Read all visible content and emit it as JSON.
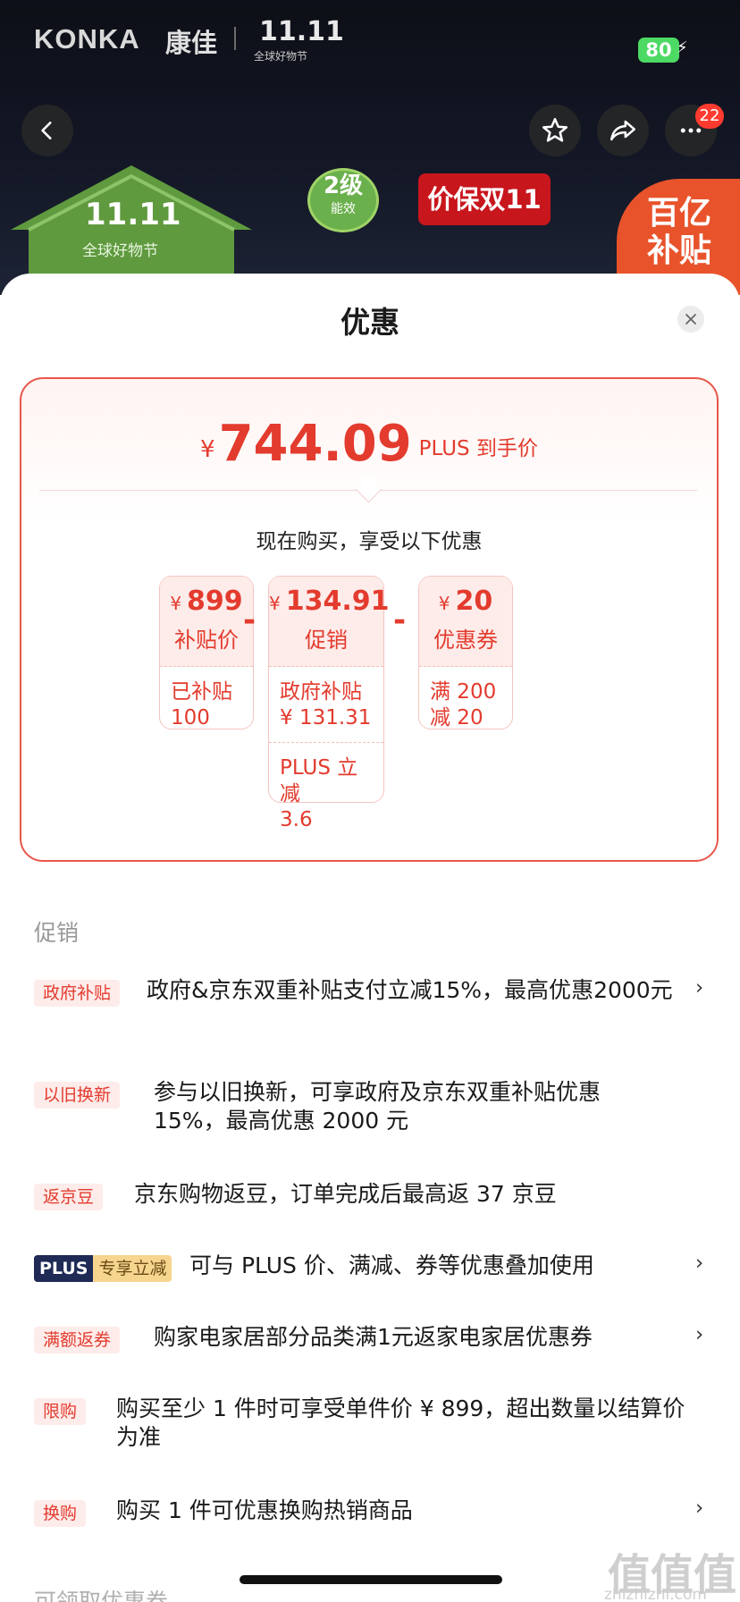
{
  "header": {
    "brand": "KONKA",
    "brand_cn": "康佳",
    "event_logo": "11.11",
    "event_sub": "全球好物节",
    "battery": "80",
    "cart_badge": "22",
    "banner_house_title": "11.11",
    "banner_house_sub": "全球好物节",
    "energy_level": "2级",
    "energy_label": "能效",
    "price_protect": "价保双11",
    "subsidy_line1": "百亿",
    "subsidy_line2": "补贴"
  },
  "sheet": {
    "title": "优惠",
    "final_currency": "¥",
    "final_price": "744.09",
    "final_label": "PLUS 到手价",
    "subheading": "现在购买，享受以下优惠",
    "breakdown": [
      {
        "currency": "¥",
        "amount": "899",
        "label": "补贴价",
        "lines": [
          "已补贴\n100"
        ]
      },
      {
        "currency": "¥",
        "amount": "134.91",
        "label": "促销",
        "lines": [
          "政府补贴\n¥ 131.31",
          "PLUS 立减\n3.6"
        ]
      },
      {
        "currency": "¥",
        "amount": "20",
        "label": "优惠券",
        "lines": [
          "满 200\n减 20"
        ]
      }
    ],
    "minus_sign": "-"
  },
  "promotions": {
    "section_label": "促销",
    "items": [
      {
        "tag": "政府补贴",
        "text": "政府&京东双重补贴支付立减15%，最高优惠2000元",
        "has_arrow": true
      },
      {
        "tag": "以旧换新",
        "text": "参与以旧换新，可享政府及京东双重补贴优惠15%，最高优惠 2000 元",
        "has_arrow": false
      },
      {
        "tag": "返京豆",
        "text": "京东购物返豆，订单完成后最高返 37 京豆",
        "has_arrow": false
      },
      {
        "tag_plus": "PLUS",
        "tag_plus_sub": "专享立减",
        "text": "可与 PLUS 价、满减、券等优惠叠加使用",
        "has_arrow": true
      },
      {
        "tag": "满额返券",
        "text": "购家电家居部分品类满1元返家电家居优惠券",
        "has_arrow": true
      },
      {
        "tag": "限购",
        "text": "购买至少 1 件时可享受单件价 ¥ 899，超出数量以结算价为准",
        "has_arrow": false
      },
      {
        "tag": "换购",
        "text": "购买 1 件可优惠换购热销商品",
        "has_arrow": true
      }
    ],
    "next_section_label": "可领取优惠券",
    "arrow": "›"
  },
  "watermark": {
    "text": "值值值",
    "url": "zhizhizhi.com"
  }
}
